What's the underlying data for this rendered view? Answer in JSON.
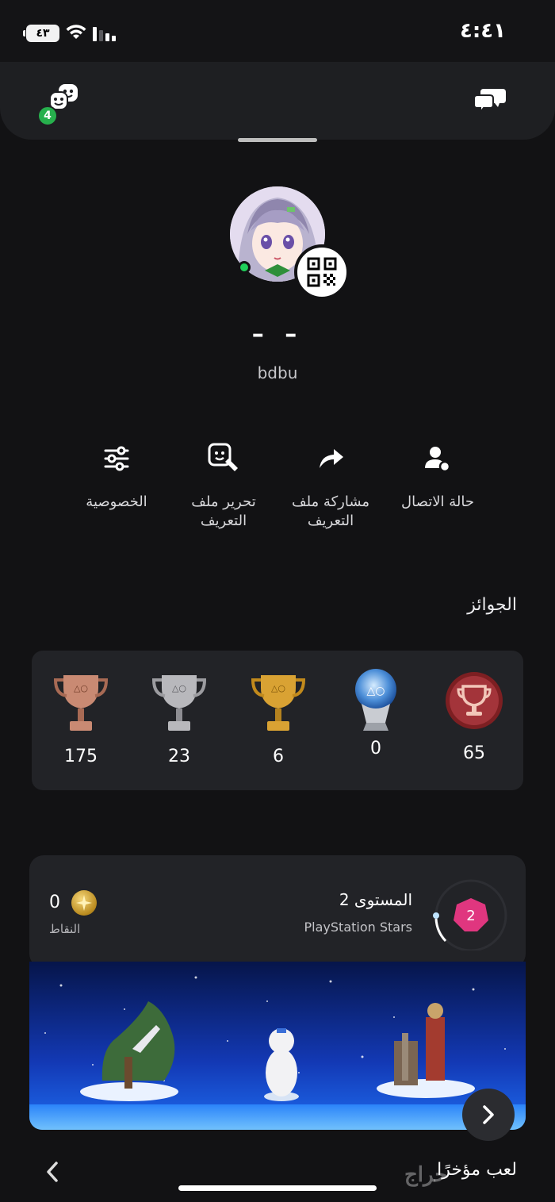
{
  "status_bar": {
    "time": "٤:٤١",
    "battery": "٤٣",
    "icons": [
      "battery-icon",
      "wifi-icon",
      "signal-icon"
    ]
  },
  "header": {
    "notification_count": "4",
    "left_icon": "friends-icon",
    "right_icon": "chat-bubbles-icon"
  },
  "profile": {
    "display_name": "– –",
    "online_id": "bdbu",
    "online_status": "online",
    "qr_icon": "qr-code-icon"
  },
  "actions": [
    {
      "label": "حالة الاتصال",
      "icon": "user-status-icon"
    },
    {
      "label": "مشاركة ملف التعريف",
      "icon": "share-arrow-icon"
    },
    {
      "label": "تحرير ملف التعريف",
      "icon": "edit-profile-icon"
    },
    {
      "label": "الخصوصية",
      "icon": "sliders-icon"
    }
  ],
  "trophies": {
    "title": "الجوائز",
    "level": "65",
    "platinum": "0",
    "gold": "6",
    "silver": "23",
    "bronze": "175",
    "colors": {
      "bronze": "#c98a73",
      "silver": "#b8b8bc",
      "gold": "#d9a233",
      "platinum": "#7fb1e6",
      "level": "#9b2a2a"
    }
  },
  "stars": {
    "level_text": "المستوى 2",
    "level_number": "2",
    "program": "PlayStation Stars",
    "points_value": "0",
    "points_label": "النقاط",
    "level_color": "#e0367f"
  },
  "recent": {
    "title": "لعب مؤخرًا"
  },
  "watermark": "حراج"
}
